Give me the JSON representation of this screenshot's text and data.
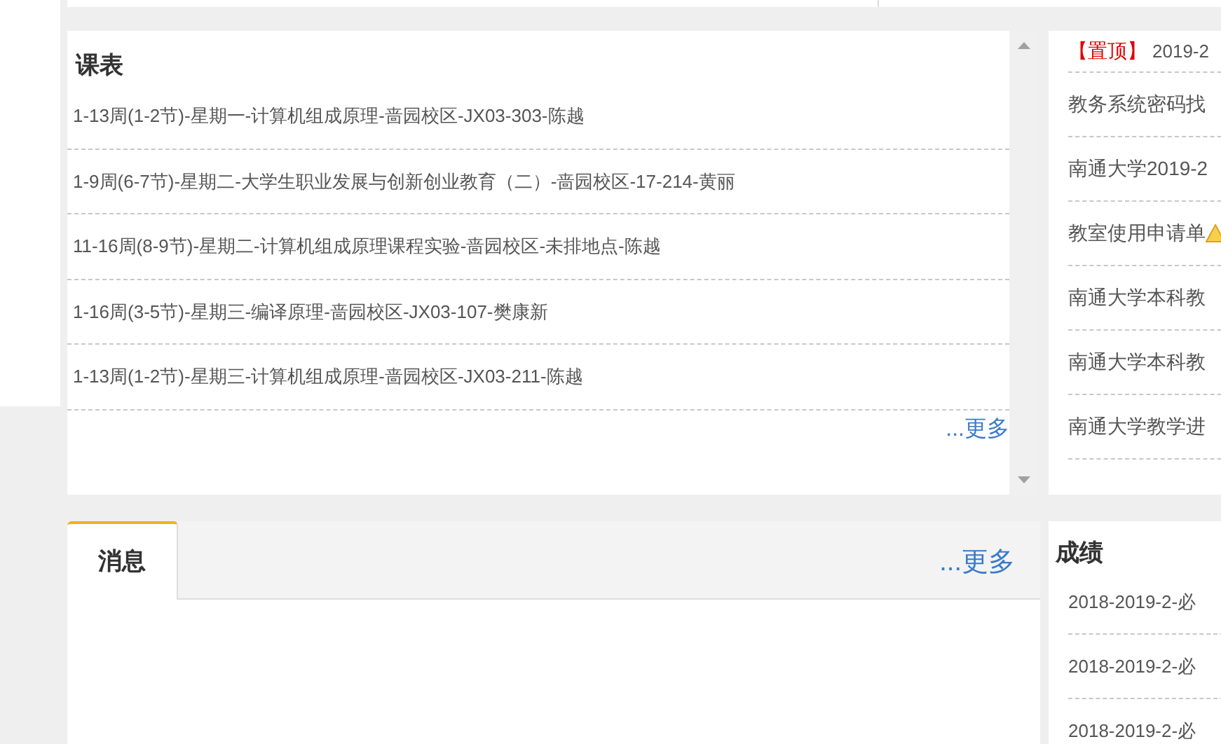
{
  "schedule": {
    "title": "课表",
    "items": [
      "1-13周(1-2节)-星期一-计算机组成原理-啬园校区-JX03-303-陈越",
      "1-9周(6-7节)-星期二-大学生职业发展与创新创业教育（二）-啬园校区-17-214-黄丽",
      "11-16周(8-9节)-星期二-计算机组成原理课程实验-啬园校区-未排地点-陈越",
      "1-16周(3-5节)-星期三-编译原理-啬园校区-JX03-107-樊康新",
      "1-13周(1-2节)-星期三-计算机组成原理-啬园校区-JX03-211-陈越"
    ],
    "more": "...更多"
  },
  "notices": [
    {
      "tag": "【置顶】",
      "text": "2019-2",
      "warning": false
    },
    {
      "text": "教务系统密码找",
      "warning": false
    },
    {
      "text": "南通大学2019-2",
      "warning": false
    },
    {
      "text": "教室使用申请单",
      "warning": true
    },
    {
      "text": "南通大学本科教",
      "warning": false
    },
    {
      "text": "南通大学本科教",
      "warning": false
    },
    {
      "text": "南通大学教学进",
      "warning": false
    }
  ],
  "messages": {
    "tabs": [
      {
        "label": "消息",
        "selected": true
      }
    ],
    "more": "...更多"
  },
  "grades": {
    "title": "成绩",
    "items": [
      "2018-2019-2-必",
      "2018-2019-2-必",
      "2018-2019-2-必"
    ]
  }
}
